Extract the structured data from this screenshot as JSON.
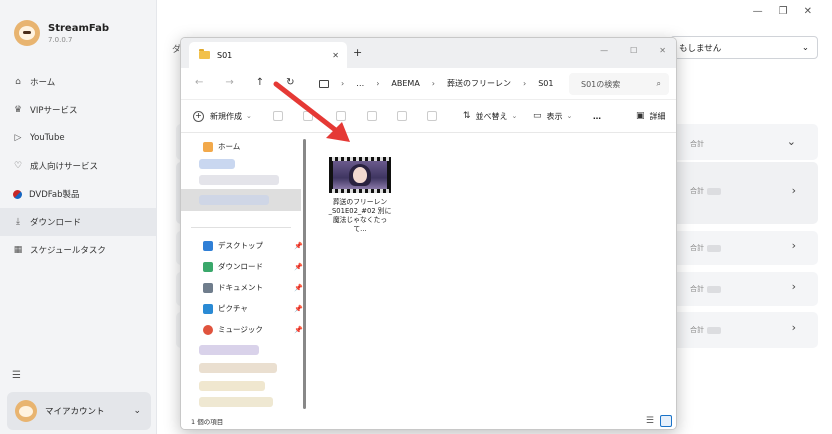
{
  "app": {
    "name": "StreamFab",
    "version": "7.0.0.7"
  },
  "sidebar": {
    "items": [
      {
        "label": "ホーム",
        "icon": "home-icon"
      },
      {
        "label": "VIPサービス",
        "icon": "vip-icon"
      },
      {
        "label": "YouTube",
        "icon": "youtube-icon"
      },
      {
        "label": "成人向けサービス",
        "icon": "heart-icon"
      },
      {
        "label": "DVDFab製品",
        "icon": "dvdfab-icon"
      },
      {
        "label": "ダウンロード",
        "icon": "download-icon"
      },
      {
        "label": "スケジュールタスク",
        "icon": "calendar-icon"
      }
    ],
    "active_index": 5,
    "account_label": "マイアカウント"
  },
  "main": {
    "header_fragment": "ダ",
    "filter_value": "もしません",
    "rows": [
      {
        "total_label": "合計"
      },
      {
        "total_label": "合計"
      },
      {
        "total_label": "合計"
      },
      {
        "total_label": "合計"
      },
      {
        "total_label": "合計"
      }
    ]
  },
  "explorer": {
    "tab_title": "S01",
    "breadcrumbs": [
      "…",
      "ABEMA",
      "葬送のフリーレン",
      "S01"
    ],
    "search_placeholder": "S01の検索",
    "toolbar": {
      "new_label": "新規作成",
      "sort_label": "並べ替え",
      "view_label": "表示",
      "more_label": "…",
      "detail_label": "詳細"
    },
    "nav_pane": {
      "home_label": "ホーム",
      "quick_access": [
        {
          "label": "デスクトップ",
          "icon": "desktop-icon",
          "color": "#2f7fd6"
        },
        {
          "label": "ダウンロード",
          "icon": "download-icon",
          "color": "#3aa86b"
        },
        {
          "label": "ドキュメント",
          "icon": "document-icon",
          "color": "#6f7d8c"
        },
        {
          "label": "ピクチャ",
          "icon": "pictures-icon",
          "color": "#2a8ad4"
        },
        {
          "label": "ミュージック",
          "icon": "music-icon",
          "color": "#e0533d"
        }
      ]
    },
    "file": {
      "name": "葬送のフリーレン_S01E02_#02 別に魔法じゃなくたって..."
    },
    "status_text": "1 個の項目"
  },
  "colors": {
    "arrow": "#e53935",
    "folder": "#f2c14b",
    "accent": "#1a73c8"
  }
}
